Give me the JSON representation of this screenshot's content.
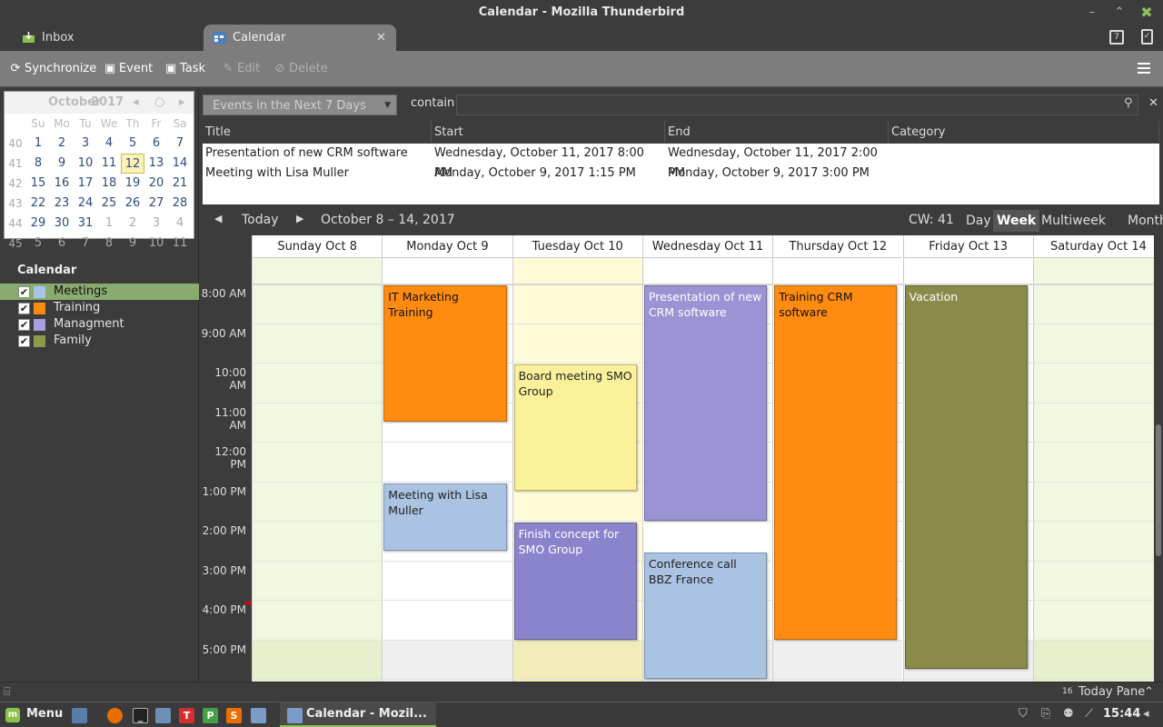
{
  "window": {
    "title": "Calendar - Mozilla Thunderbird"
  },
  "tabs": [
    {
      "label": "Inbox"
    },
    {
      "label": "Calendar"
    }
  ],
  "toolbar": {
    "synchronize": "Synchronize",
    "event": "Event",
    "task": "Task",
    "edit": "Edit",
    "delete": "Delete"
  },
  "minical": {
    "month": "October",
    "year": "2017",
    "day_names": [
      "Su",
      "Mo",
      "Tu",
      "We",
      "Th",
      "Fr",
      "Sa"
    ],
    "weeks": [
      {
        "wk": "40",
        "days": [
          "1",
          "2",
          "3",
          "4",
          "5",
          "6",
          "7"
        ]
      },
      {
        "wk": "41",
        "days": [
          "8",
          "9",
          "10",
          "11",
          "12",
          "13",
          "14"
        ]
      },
      {
        "wk": "42",
        "days": [
          "15",
          "16",
          "17",
          "18",
          "19",
          "20",
          "21"
        ]
      },
      {
        "wk": "43",
        "days": [
          "22",
          "23",
          "24",
          "25",
          "26",
          "27",
          "28"
        ]
      },
      {
        "wk": "44",
        "days": [
          "29",
          "30",
          "31",
          "1",
          "2",
          "3",
          "4"
        ]
      },
      {
        "wk": "45",
        "days": [
          "5",
          "6",
          "7",
          "8",
          "9",
          "10",
          "11"
        ]
      }
    ],
    "today": "12"
  },
  "calendars": {
    "header": "Calendar",
    "items": [
      {
        "label": "Meetings",
        "color": "#a8c4e8"
      },
      {
        "label": "Training",
        "color": "#ff8b10"
      },
      {
        "label": "Managment",
        "color": "#a79fe0"
      },
      {
        "label": "Family",
        "color": "#8a9a48"
      }
    ]
  },
  "search": {
    "filter": "Events in the Next 7 Days",
    "contain": "contain"
  },
  "event_list": {
    "columns": [
      "Title",
      "Start",
      "End",
      "Category"
    ],
    "rows": [
      {
        "title": "Presentation of new CRM software",
        "start": "Wednesday, October 11, 2017 8:00 AM",
        "end": "Wednesday, October 11, 2017 2:00 PM"
      },
      {
        "title": "Meeting with Lisa Muller",
        "start": "Monday, October 9, 2017 1:15 PM",
        "end": "Monday, October 9, 2017 3:00 PM"
      }
    ]
  },
  "nav": {
    "today": "Today",
    "range": "October 8 – 14, 2017",
    "cw": "CW: 41",
    "views": [
      "Day",
      "Week",
      "Multiweek",
      "Month"
    ],
    "active_view": "Week"
  },
  "week": {
    "days": [
      "Sunday Oct 8",
      "Monday Oct 9",
      "Tuesday Oct 10",
      "Wednesday Oct 11",
      "Thursday Oct 12",
      "Friday Oct 13",
      "Saturday Oct 14"
    ],
    "hours": [
      "8:00 AM",
      "9:00 AM",
      "10:00 AM",
      "11:00 AM",
      "12:00 PM",
      "1:00 PM",
      "2:00 PM",
      "3:00 PM",
      "4:00 PM",
      "5:00 PM"
    ],
    "events": [
      {
        "title": "IT Marketing Training",
        "day": 1,
        "start": 8.0,
        "end": 11.5,
        "color": "#ff8b10",
        "text": "#111"
      },
      {
        "title": "Meeting with Lisa Muller",
        "day": 1,
        "start": 13.0,
        "end": 14.75,
        "color": "#abc3e3",
        "text": "#222"
      },
      {
        "title": "Board meeting SMO Group",
        "day": 2,
        "start": 10.0,
        "end": 13.25,
        "color": "#fbf19a",
        "text": "#222"
      },
      {
        "title": "Finish concept for SMO Group",
        "day": 2,
        "start": 14.0,
        "end": 17.0,
        "color": "#8a84cc",
        "text": "#fff"
      },
      {
        "title": "Presentation of new CRM software",
        "day": 3,
        "start": 8.0,
        "end": 14.0,
        "color": "#9a94d4",
        "text": "#fff"
      },
      {
        "title": "Conference call BBZ France",
        "day": 3,
        "start": 14.75,
        "end": 18.0,
        "color": "#abc3e3",
        "text": "#222"
      },
      {
        "title": "Training CRM software",
        "day": 4,
        "start": 8.0,
        "end": 17.0,
        "color": "#ff8b10",
        "text": "#111"
      },
      {
        "title": "Vacation",
        "day": 5,
        "start": 8.0,
        "end": 17.75,
        "color": "#8a8a4a",
        "text": "#fff"
      }
    ]
  },
  "statusbar": {
    "today_pane": "Today Pane",
    "today_num": "16"
  },
  "taskbar": {
    "menu": "Menu",
    "window": "Calendar - Mozil...",
    "clock": "15:44"
  }
}
